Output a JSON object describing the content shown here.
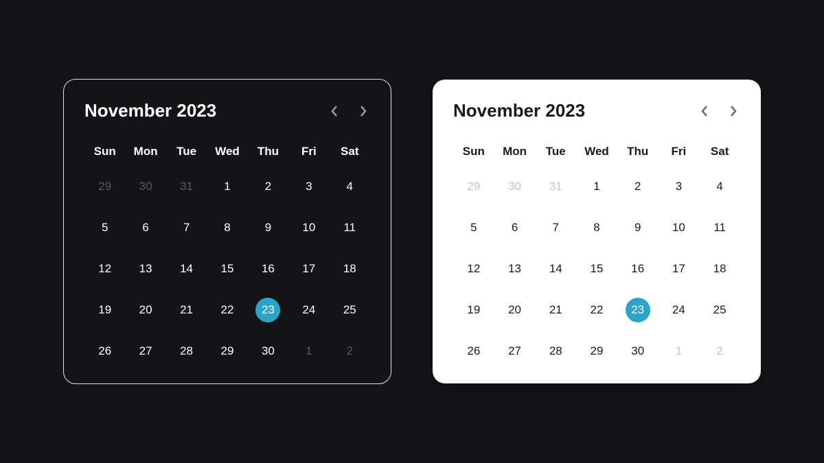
{
  "calendar": {
    "title": "November 2023",
    "weekdays": [
      "Sun",
      "Mon",
      "Tue",
      "Wed",
      "Thu",
      "Fri",
      "Sat"
    ],
    "days": [
      {
        "n": "29",
        "muted": true
      },
      {
        "n": "30",
        "muted": true
      },
      {
        "n": "31",
        "muted": true
      },
      {
        "n": "1"
      },
      {
        "n": "2"
      },
      {
        "n": "3"
      },
      {
        "n": "4"
      },
      {
        "n": "5"
      },
      {
        "n": "6"
      },
      {
        "n": "7"
      },
      {
        "n": "8"
      },
      {
        "n": "9"
      },
      {
        "n": "10"
      },
      {
        "n": "11"
      },
      {
        "n": "12"
      },
      {
        "n": "13"
      },
      {
        "n": "14"
      },
      {
        "n": "15"
      },
      {
        "n": "16"
      },
      {
        "n": "17"
      },
      {
        "n": "18"
      },
      {
        "n": "19"
      },
      {
        "n": "20"
      },
      {
        "n": "21"
      },
      {
        "n": "22"
      },
      {
        "n": "23",
        "selected": true
      },
      {
        "n": "24"
      },
      {
        "n": "25"
      },
      {
        "n": "26"
      },
      {
        "n": "27"
      },
      {
        "n": "28"
      },
      {
        "n": "29"
      },
      {
        "n": "30"
      },
      {
        "n": "1",
        "muted": true
      },
      {
        "n": "2",
        "muted": true
      }
    ],
    "selected_day": "23",
    "accent_color": "#2aa5c9"
  }
}
